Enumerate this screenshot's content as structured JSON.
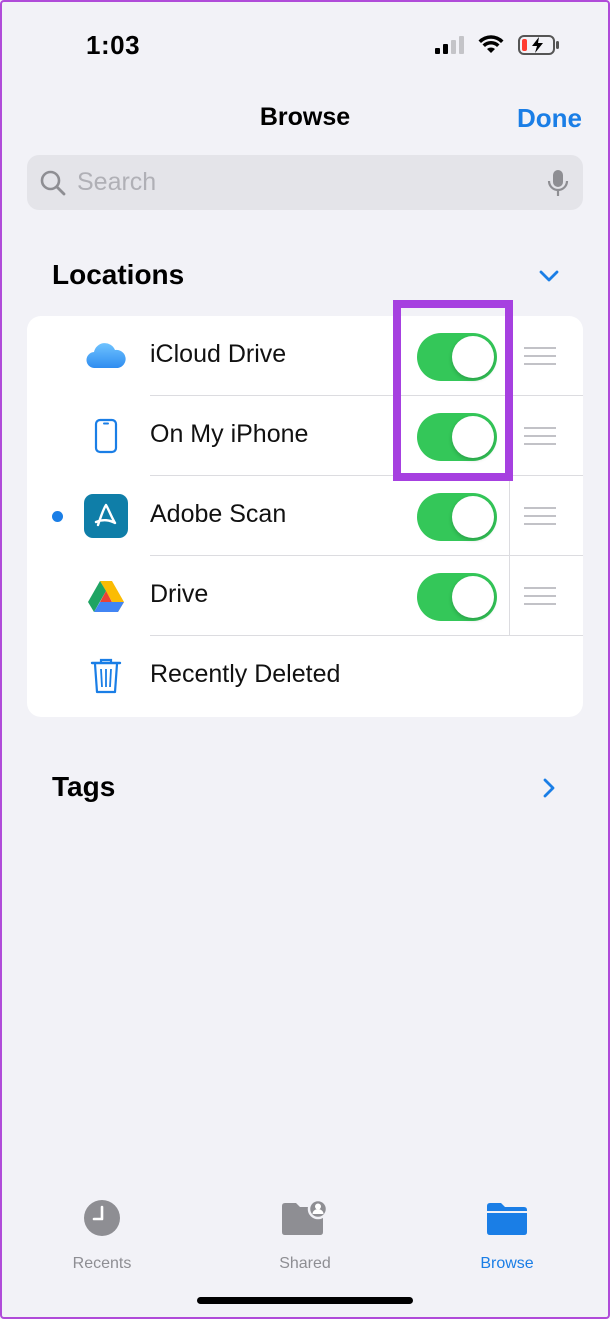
{
  "status": {
    "time": "1:03"
  },
  "nav": {
    "title": "Browse",
    "done_label": "Done"
  },
  "search": {
    "placeholder": "Search"
  },
  "locations": {
    "title": "Locations",
    "items": [
      {
        "label": "iCloud Drive",
        "icon": "icloud-icon",
        "enabled": true
      },
      {
        "label": "On My iPhone",
        "icon": "iphone-icon",
        "enabled": true
      },
      {
        "label": "Adobe Scan",
        "icon": "adobe-scan-icon",
        "enabled": true,
        "unread_dot": true
      },
      {
        "label": "Drive",
        "icon": "google-drive-icon",
        "enabled": true
      },
      {
        "label": "Recently Deleted",
        "icon": "trash-icon"
      }
    ]
  },
  "tags": {
    "title": "Tags"
  },
  "tabbar": {
    "items": [
      {
        "label": "Recents",
        "icon": "clock-icon",
        "active": false
      },
      {
        "label": "Shared",
        "icon": "shared-folder-icon",
        "active": false
      },
      {
        "label": "Browse",
        "icon": "folder-icon",
        "active": true
      }
    ]
  },
  "colors": {
    "accent": "#1a7ee6",
    "toggle_on": "#34c759",
    "highlight": "#a640e0"
  }
}
